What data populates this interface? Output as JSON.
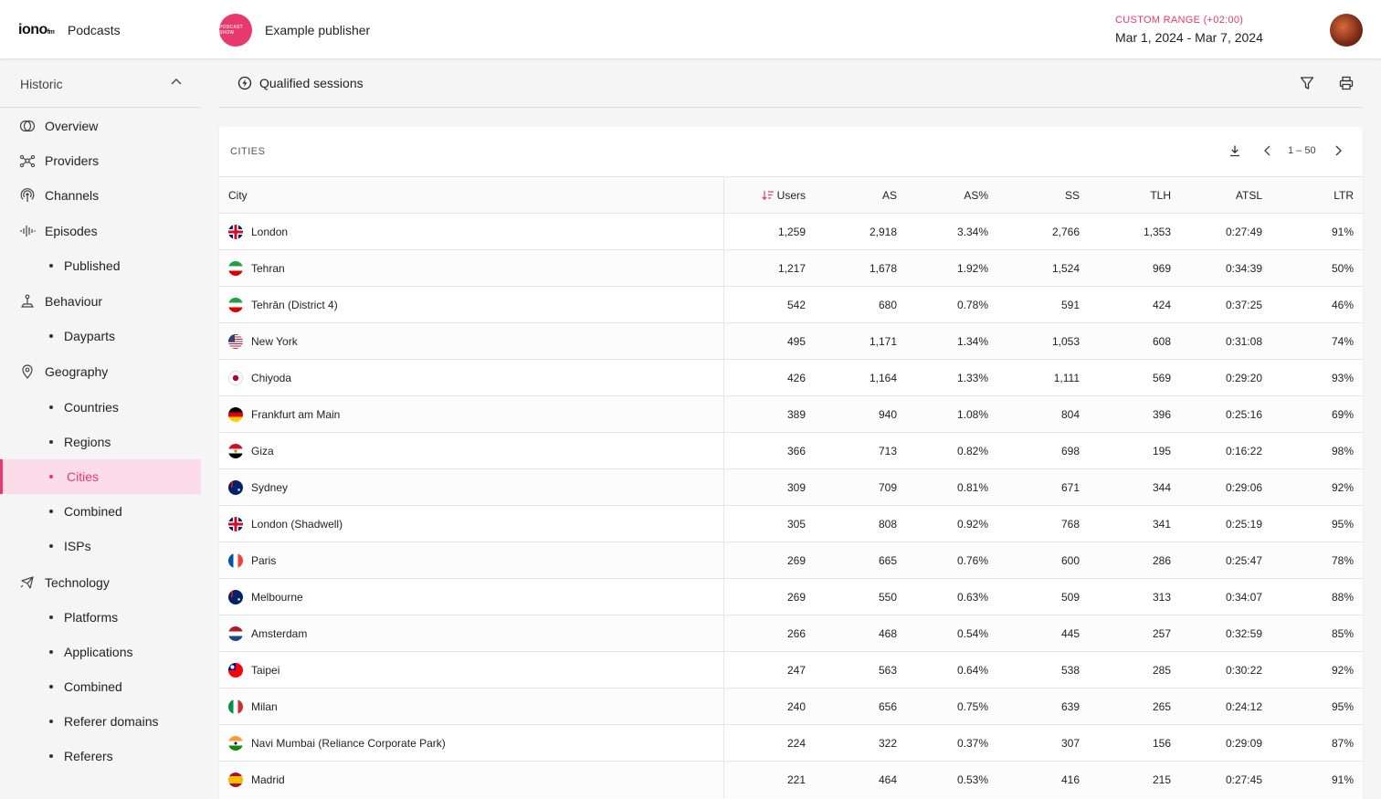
{
  "header": {
    "logo": "iono",
    "logo_suffix": "fm",
    "app_name": "Podcasts",
    "publisher_avatar_text": "PODCAST SHOW",
    "publisher": "Example publisher",
    "range_label": "CUSTOM RANGE (+02:00)",
    "range_value": "Mar 1, 2024 - Mar 7, 2024"
  },
  "sidebar": {
    "section": "Historic",
    "items": [
      {
        "label": "Overview",
        "icon": "overview-icon"
      },
      {
        "label": "Providers",
        "icon": "providers-icon"
      },
      {
        "label": "Channels",
        "icon": "channels-icon"
      },
      {
        "label": "Episodes",
        "icon": "episodes-icon"
      },
      {
        "label": "Published"
      },
      {
        "label": "Behaviour",
        "icon": "behaviour-icon"
      },
      {
        "label": "Dayparts"
      },
      {
        "label": "Geography",
        "icon": "geography-icon"
      },
      {
        "label": "Countries"
      },
      {
        "label": "Regions"
      },
      {
        "label": "Cities",
        "active": true
      },
      {
        "label": "Combined"
      },
      {
        "label": "ISPs"
      },
      {
        "label": "Technology",
        "icon": "technology-icon"
      },
      {
        "label": "Platforms"
      },
      {
        "label": "Applications"
      },
      {
        "label": "Combined"
      },
      {
        "label": "Referer domains"
      },
      {
        "label": "Referers"
      }
    ]
  },
  "toolbar": {
    "title": "Qualified sessions"
  },
  "table": {
    "title": "CITIES",
    "page_range": "1 – 50",
    "columns": [
      "City",
      "Users",
      "AS",
      "AS%",
      "SS",
      "TLH",
      "ATSL",
      "LTR"
    ],
    "sort_column": "Users",
    "accent_color": "#e8386d",
    "rows": [
      {
        "flag": "gb",
        "cells": [
          "London",
          "1,259",
          "2,918",
          "3.34%",
          "2,766",
          "1,353",
          "0:27:49",
          "91%"
        ]
      },
      {
        "flag": "ir",
        "cells": [
          "Tehran",
          "1,217",
          "1,678",
          "1.92%",
          "1,524",
          "969",
          "0:34:39",
          "50%"
        ]
      },
      {
        "flag": "ir",
        "cells": [
          "Tehrān (District 4)",
          "542",
          "680",
          "0.78%",
          "591",
          "424",
          "0:37:25",
          "46%"
        ]
      },
      {
        "flag": "us",
        "cells": [
          "New York",
          "495",
          "1,171",
          "1.34%",
          "1,053",
          "608",
          "0:31:08",
          "74%"
        ]
      },
      {
        "flag": "jp",
        "cells": [
          "Chiyoda",
          "426",
          "1,164",
          "1.33%",
          "1,111",
          "569",
          "0:29:20",
          "93%"
        ]
      },
      {
        "flag": "de",
        "cells": [
          "Frankfurt am Main",
          "389",
          "940",
          "1.08%",
          "804",
          "396",
          "0:25:16",
          "69%"
        ]
      },
      {
        "flag": "eg",
        "cells": [
          "Giza",
          "366",
          "713",
          "0.82%",
          "698",
          "195",
          "0:16:22",
          "98%"
        ]
      },
      {
        "flag": "au",
        "cells": [
          "Sydney",
          "309",
          "709",
          "0.81%",
          "671",
          "344",
          "0:29:06",
          "92%"
        ]
      },
      {
        "flag": "gb",
        "cells": [
          "London (Shadwell)",
          "305",
          "808",
          "0.92%",
          "768",
          "341",
          "0:25:19",
          "95%"
        ]
      },
      {
        "flag": "fr",
        "cells": [
          "Paris",
          "269",
          "665",
          "0.76%",
          "600",
          "286",
          "0:25:47",
          "78%"
        ]
      },
      {
        "flag": "au",
        "cells": [
          "Melbourne",
          "269",
          "550",
          "0.63%",
          "509",
          "313",
          "0:34:07",
          "88%"
        ]
      },
      {
        "flag": "nl",
        "cells": [
          "Amsterdam",
          "266",
          "468",
          "0.54%",
          "445",
          "257",
          "0:32:59",
          "85%"
        ]
      },
      {
        "flag": "tw",
        "cells": [
          "Taipei",
          "247",
          "563",
          "0.64%",
          "538",
          "285",
          "0:30:22",
          "92%"
        ]
      },
      {
        "flag": "it",
        "cells": [
          "Milan",
          "240",
          "656",
          "0.75%",
          "639",
          "265",
          "0:24:12",
          "95%"
        ]
      },
      {
        "flag": "in",
        "cells": [
          "Navi Mumbai (Reliance Corporate Park)",
          "224",
          "322",
          "0.37%",
          "307",
          "156",
          "0:29:09",
          "87%"
        ]
      },
      {
        "flag": "es",
        "cells": [
          "Madrid",
          "221",
          "464",
          "0.53%",
          "416",
          "215",
          "0:27:45",
          "91%"
        ]
      }
    ]
  }
}
